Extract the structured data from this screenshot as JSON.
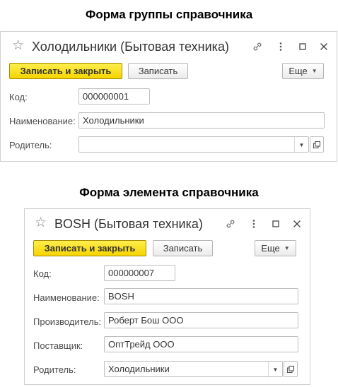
{
  "group_form": {
    "caption": "Форма группы справочника",
    "title": "Холодильники (Бытовая техника)",
    "buttons": {
      "save_close": "Записать и закрыть",
      "save": "Записать",
      "more": "Еще"
    },
    "fields": {
      "code_label": "Код:",
      "code_value": "000000001",
      "name_label": "Наименование:",
      "name_value": "Холодильники",
      "parent_label": "Родитель:",
      "parent_value": ""
    }
  },
  "element_form": {
    "caption": "Форма элемента справочника",
    "title": "BOSH (Бытовая техника)",
    "buttons": {
      "save_close": "Записать и закрыть",
      "save": "Записать",
      "more": "Еще"
    },
    "fields": {
      "code_label": "Код:",
      "code_value": "000000007",
      "name_label": "Наименование:",
      "name_value": "BOSH",
      "manufacturer_label": "Производитель:",
      "manufacturer_value": "Роберт Бош ООО",
      "supplier_label": "Поставщик:",
      "supplier_value": "ОптТрейд ООО",
      "parent_label": "Родитель:",
      "parent_value": "Холодильники"
    }
  },
  "icons": [
    "star-icon",
    "link-icon",
    "more-vertical-icon",
    "maximize-icon",
    "close-icon",
    "dropdown-arrow-icon",
    "open-icon"
  ],
  "colors": {
    "primary_button": "#f5d400",
    "border": "#bfbfbf"
  }
}
